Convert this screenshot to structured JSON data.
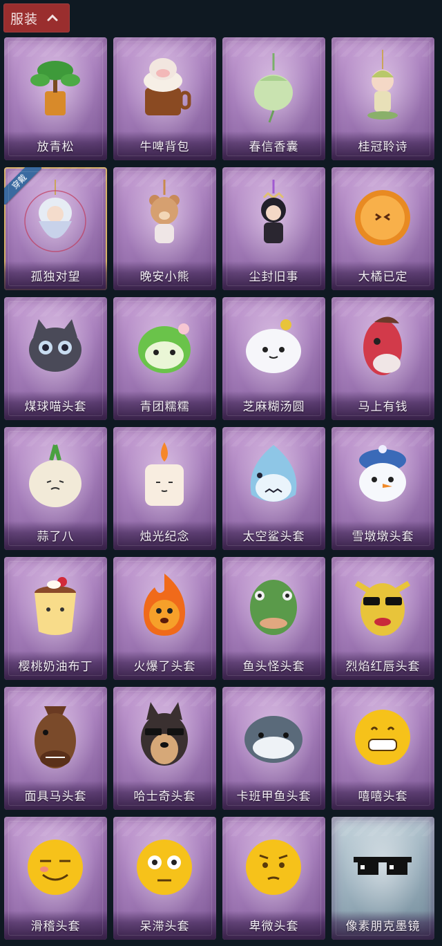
{
  "header": {
    "label": "服装",
    "icon": "chevron-up-icon"
  },
  "accent_colors": {
    "header_bg": "#9a2e2e",
    "card_purple": "#a77fbc",
    "card_blue": "#9bb0bd",
    "worn_border": "#d8b36a",
    "worn_badge": "#3a6aa0"
  },
  "items": [
    {
      "name": "放青松",
      "icon": "bonsai-pine-icon",
      "theme": "purple"
    },
    {
      "name": "牛啤背包",
      "icon": "cow-beer-mug-icon",
      "theme": "purple"
    },
    {
      "name": "春信香囊",
      "icon": "sachet-icon",
      "theme": "purple"
    },
    {
      "name": "桂冠聆诗",
      "icon": "laurel-fairy-charm-icon",
      "theme": "purple"
    },
    {
      "name": "孤独对望",
      "icon": "silver-hair-doll-icon",
      "theme": "purple",
      "worn": true,
      "badge": "穿戴"
    },
    {
      "name": "晚安小熊",
      "icon": "teddy-bear-charm-icon",
      "theme": "purple"
    },
    {
      "name": "尘封旧事",
      "icon": "dark-prince-doll-icon",
      "theme": "purple"
    },
    {
      "name": "大橘已定",
      "icon": "orange-slice-icon",
      "theme": "purple"
    },
    {
      "name": "煤球喵头套",
      "icon": "black-cat-head-icon",
      "theme": "purple"
    },
    {
      "name": "青团糯糯",
      "icon": "green-rice-ball-icon",
      "theme": "purple"
    },
    {
      "name": "芝麻糊汤圆",
      "icon": "rice-dumpling-icon",
      "theme": "purple"
    },
    {
      "name": "马上有钱",
      "icon": "red-horse-head-icon",
      "theme": "purple"
    },
    {
      "name": "蒜了八",
      "icon": "garlic-icon",
      "theme": "purple"
    },
    {
      "name": "烛光纪念",
      "icon": "candle-icon",
      "theme": "purple"
    },
    {
      "name": "太空鲨头套",
      "icon": "shark-head-icon",
      "theme": "purple"
    },
    {
      "name": "雪墩墩头套",
      "icon": "snowman-head-icon",
      "theme": "purple"
    },
    {
      "name": "樱桃奶油布丁",
      "icon": "pudding-icon",
      "theme": "purple"
    },
    {
      "name": "火爆了头套",
      "icon": "fire-head-icon",
      "theme": "purple"
    },
    {
      "name": "鱼头怪头套",
      "icon": "fish-mask-icon",
      "theme": "purple"
    },
    {
      "name": "烈焰红唇头套",
      "icon": "yellow-mask-sunglasses-icon",
      "theme": "purple"
    },
    {
      "name": "面具马头套",
      "icon": "horse-mask-icon",
      "theme": "purple"
    },
    {
      "name": "哈士奇头套",
      "icon": "husky-head-icon",
      "theme": "purple"
    },
    {
      "name": "卡班甲鱼头套",
      "icon": "turtle-head-icon",
      "theme": "purple"
    },
    {
      "name": "嘻嘻头套",
      "icon": "grin-emoji-head-icon",
      "theme": "purple"
    },
    {
      "name": "滑稽头套",
      "icon": "smirk-emoji-head-icon",
      "theme": "purple"
    },
    {
      "name": "呆滞头套",
      "icon": "stare-emoji-head-icon",
      "theme": "purple"
    },
    {
      "name": "卑微头套",
      "icon": "shy-emoji-head-icon",
      "theme": "purple"
    },
    {
      "name": "像素朋克墨镜",
      "icon": "pixel-sunglasses-icon",
      "theme": "blue"
    }
  ]
}
